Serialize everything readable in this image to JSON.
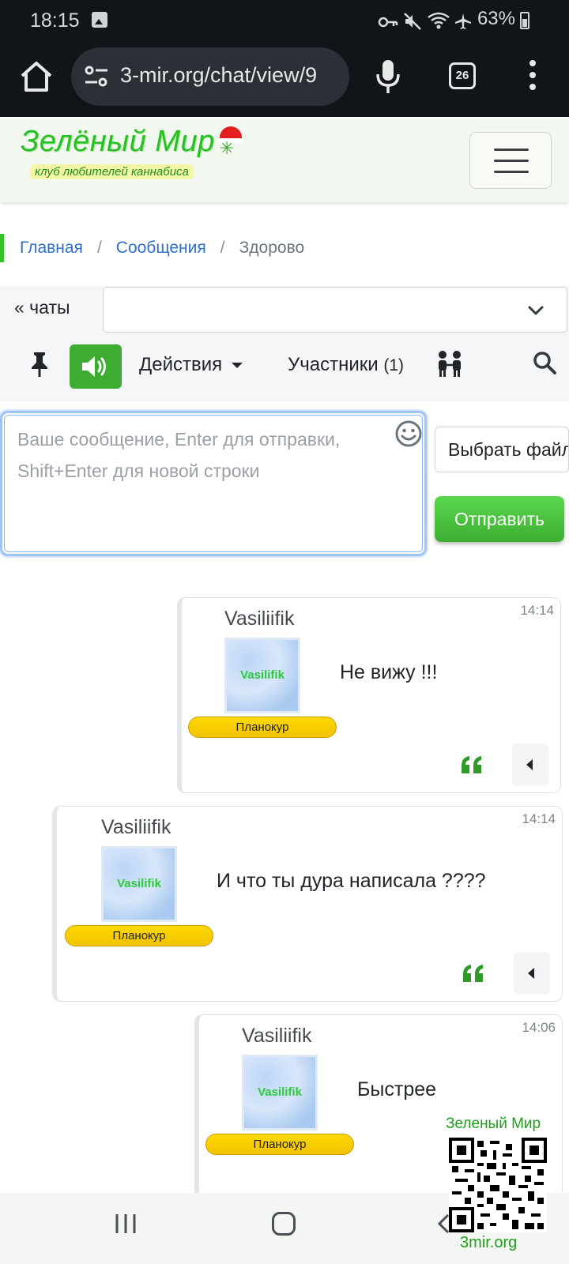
{
  "status_bar": {
    "time": "18:15",
    "battery": "63%",
    "icons": [
      "gallery-icon",
      "vpn-key-icon",
      "mute-icon",
      "wifi-icon",
      "airplane-icon",
      "battery-icon"
    ]
  },
  "browser": {
    "url": "3-mir.org/chat/view/9",
    "tab_count": "26",
    "icons": [
      "home-icon",
      "site-settings-icon",
      "mic-icon",
      "tabs-icon",
      "more-vert-icon"
    ]
  },
  "site": {
    "logo_title": "Зелёный Мир",
    "logo_subtitle": "клуб любителей каннабиса",
    "brand_color": "#2bbf27"
  },
  "breadcrumb": {
    "home": "Главная",
    "messages": "Сообщения",
    "current": "Здорово"
  },
  "chat_controls": {
    "back_label": "« чаты",
    "select_value": "",
    "actions_label": "Действия",
    "participants_label": "Участники",
    "participants_count": "(1)"
  },
  "composer": {
    "placeholder": "Ваше сообщение, Enter для отправки, Shift+Enter для новой строки",
    "file_button": "Выбрать файл",
    "send_button": "Отправить"
  },
  "messages": [
    {
      "author": "Vasiliifik",
      "avatar_text": "Vasilifik",
      "rank": "Планокур",
      "text": "Не вижу !!!",
      "time": "14:14"
    },
    {
      "author": "Vasiliifik",
      "avatar_text": "Vasilifik",
      "rank": "Планокур",
      "text": "И что ты дура написала ????",
      "time": "14:14"
    },
    {
      "author": "Vasiliifik",
      "avatar_text": "Vasilifik",
      "rank": "Планокур",
      "text": "Быстрее",
      "time": "14:06"
    }
  ],
  "watermark": {
    "title": "Зеленый Мир",
    "url": "3mir.org"
  }
}
